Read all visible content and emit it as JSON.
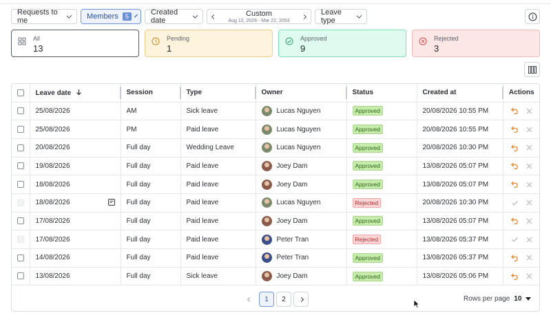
{
  "filters": {
    "requests": "Requests to me",
    "members": "Members",
    "members_count": "5",
    "created_date": "Created date",
    "range_label": "Custom",
    "range_dates": "Aug 12, 2026 - Mar 22, 2053",
    "leave_type": "Leave type"
  },
  "cards": [
    {
      "label": "All",
      "count": "13",
      "icon": "grid-icon"
    },
    {
      "label": "Pending",
      "count": "1",
      "icon": "clock-icon"
    },
    {
      "label": "Approved",
      "count": "9",
      "icon": "check-circle-icon"
    },
    {
      "label": "Rejected",
      "count": "3",
      "icon": "x-circle-icon"
    }
  ],
  "table": {
    "headers": [
      "Leave date",
      "Session",
      "Type",
      "Owner",
      "Status",
      "Created at",
      "Actions"
    ],
    "rows": [
      {
        "date": "25/08/2026",
        "session": "AM",
        "type": "Sick leave",
        "owner": "Lucas Nguyen",
        "status": "Approved",
        "created": "20/08/2026 10:55 PM",
        "avatar": "#7b8a6a",
        "selectable": true,
        "note": false,
        "actions": "revert"
      },
      {
        "date": "25/08/2026",
        "session": "PM",
        "type": "Paid leave",
        "owner": "Lucas Nguyen",
        "status": "Approved",
        "created": "20/08/2026 10:55 PM",
        "avatar": "#7b8a6a",
        "selectable": true,
        "note": false,
        "actions": "revert"
      },
      {
        "date": "20/08/2026",
        "session": "Full day",
        "type": "Wedding Leave",
        "owner": "Lucas Nguyen",
        "status": "Approved",
        "created": "20/08/2026 10:30 PM",
        "avatar": "#7b8a6a",
        "selectable": true,
        "note": false,
        "actions": "revert"
      },
      {
        "date": "19/08/2026",
        "session": "Full day",
        "type": "Paid leave",
        "owner": "Joey Dam",
        "status": "Approved",
        "created": "13/08/2026 05:07 PM",
        "avatar": "#8a5a4a",
        "selectable": true,
        "note": false,
        "actions": "revert"
      },
      {
        "date": "18/08/2026",
        "session": "Full day",
        "type": "Paid leave",
        "owner": "Joey Dam",
        "status": "Approved",
        "created": "13/08/2026 05:07 PM",
        "avatar": "#8a5a4a",
        "selectable": true,
        "note": false,
        "actions": "revert"
      },
      {
        "date": "18/08/2026",
        "session": "Full day",
        "type": "Paid leave",
        "owner": "Lucas Nguyen",
        "status": "Rejected",
        "created": "20/08/2026 10:30 PM",
        "avatar": "#7b8a6a",
        "selectable": false,
        "note": true,
        "actions": "approve"
      },
      {
        "date": "17/08/2026",
        "session": "Full day",
        "type": "Paid leave",
        "owner": "Joey Dam",
        "status": "Approved",
        "created": "13/08/2026 05:07 PM",
        "avatar": "#8a5a4a",
        "selectable": true,
        "note": false,
        "actions": "revert"
      },
      {
        "date": "17/08/2026",
        "session": "Full day",
        "type": "Paid leave",
        "owner": "Peter Tran",
        "status": "Rejected",
        "created": "13/08/2026 05:37 PM",
        "avatar": "#3b4f8a",
        "selectable": false,
        "note": false,
        "actions": "approve"
      },
      {
        "date": "14/08/2026",
        "session": "Full day",
        "type": "Paid leave",
        "owner": "Peter Tran",
        "status": "Approved",
        "created": "13/08/2026 05:37 PM",
        "avatar": "#3b4f8a",
        "selectable": true,
        "note": false,
        "actions": "revert"
      },
      {
        "date": "13/08/2026",
        "session": "Full day",
        "type": "Sick leave",
        "owner": "Joey Dam",
        "status": "Approved",
        "created": "13/08/2026 05:06 PM",
        "avatar": "#8a5a4a",
        "selectable": true,
        "note": false,
        "actions": "revert"
      }
    ]
  },
  "pagination": {
    "pages": [
      "1",
      "2"
    ],
    "current": "1",
    "rows_per_page_label": "Rows per page",
    "rows_per_page": "10"
  },
  "colors": {
    "accent": "#6f94d6",
    "revert": "#e8862e",
    "approved_badge": "#c7ebac",
    "rejected_badge": "#fbd6d6"
  }
}
